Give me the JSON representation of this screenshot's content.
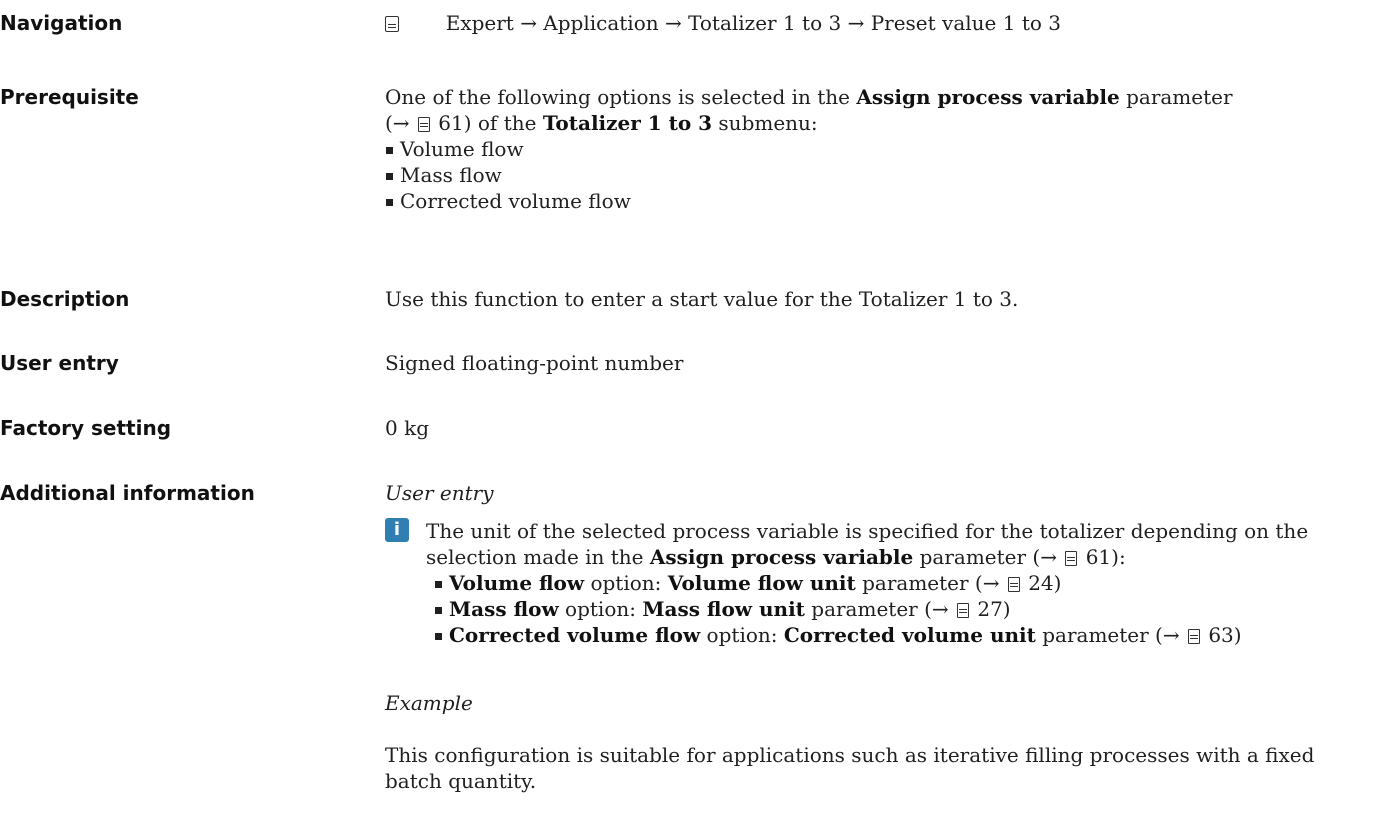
{
  "navigation": {
    "label": "Navigation",
    "path": "Expert → Application → Totalizer 1 to 3 → Preset value 1 to 3"
  },
  "prerequisite": {
    "label": "Prerequisite",
    "line1_pre": "One of the following options is selected in the ",
    "line1_bold": "Assign process variable",
    "line1_post": " parameter",
    "line2_pre": "(→ ",
    "line2_page": "61",
    "line2_mid": ") of the ",
    "line2_bold": "Totalizer 1 to 3",
    "line2_post": " submenu:",
    "options": [
      "Volume flow",
      "Mass flow",
      "Corrected volume flow"
    ]
  },
  "description": {
    "label": "Description",
    "text": "Use this function to enter a start value for the Totalizer 1 to 3."
  },
  "user_entry": {
    "label": "User entry",
    "text": "Signed floating-point number"
  },
  "factory_setting": {
    "label": "Factory setting",
    "text": "0 kg"
  },
  "additional_information": {
    "label": "Additional information",
    "sub1": "User entry",
    "info_line1": "The unit of the selected process variable is specified for the totalizer depending on the",
    "info_line2_pre": "selection made in the ",
    "info_line2_bold": "Assign process variable",
    "info_line2_post": " parameter (→ ",
    "info_line2_page": "61",
    "info_line2_end": "):",
    "items": [
      {
        "opt": "Volume flow",
        "mid": " option: ",
        "param": "Volume flow unit",
        "post": " parameter (→ ",
        "page": "24",
        "end": ")"
      },
      {
        "opt": "Mass flow",
        "mid": " option: ",
        "param": "Mass flow unit",
        "post": " parameter (→ ",
        "page": "27",
        "end": ")"
      },
      {
        "opt": "Corrected volume flow",
        "mid": " option: ",
        "param": "Corrected volume unit",
        "post": " parameter (→ ",
        "page": "63",
        "end": ")"
      }
    ],
    "sub2": "Example",
    "example_line1": "This configuration is suitable for applications such as iterative filling processes with a fixed",
    "example_line2": "batch quantity."
  }
}
